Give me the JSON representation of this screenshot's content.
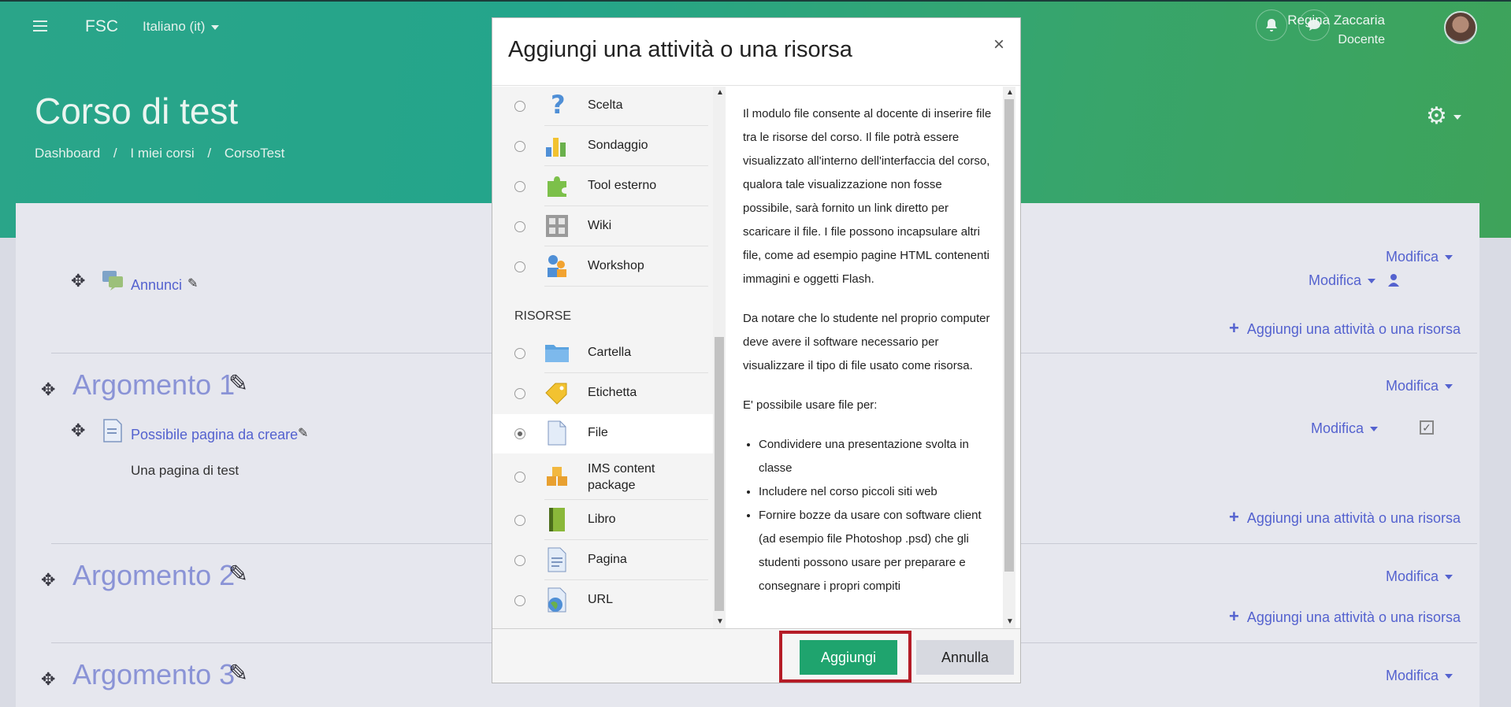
{
  "navbar": {
    "brand": "FSC",
    "language": "Italiano (it)",
    "user_name": "Regina Zaccaria",
    "user_role": "Docente"
  },
  "course": {
    "title": "Corso di test",
    "breadcrumb": [
      "Dashboard",
      "/",
      "I miei corsi",
      "/",
      "CorsoTest"
    ]
  },
  "main": {
    "edit_label": "Modifica",
    "add_activity_label": "Aggiungi una attività o una risorsa",
    "announcements": "Annunci",
    "sections": [
      {
        "title": "Argomento 1"
      },
      {
        "title": "Argomento 2"
      },
      {
        "title": "Argomento 3"
      }
    ],
    "page_item": "Possibile pagina da creare",
    "page_item_desc": "Una pagina di test"
  },
  "modal": {
    "title": "Aggiungi una attività o una risorsa",
    "close": "×",
    "resources_heading": "RISORSE",
    "options": [
      {
        "label": "Scelta",
        "icon": "question-icon",
        "selected": false
      },
      {
        "label": "Sondaggio",
        "icon": "bar-chart-icon",
        "selected": false
      },
      {
        "label": "Tool esterno",
        "icon": "puzzle-icon",
        "selected": false
      },
      {
        "label": "Wiki",
        "icon": "wiki-icon",
        "selected": false
      },
      {
        "label": "Workshop",
        "icon": "workshop-icon",
        "selected": false
      },
      {
        "label": "Cartella",
        "icon": "folder-icon",
        "selected": false
      },
      {
        "label": "Etichetta",
        "icon": "tag-icon",
        "selected": false
      },
      {
        "label": "File",
        "icon": "file-icon",
        "selected": true
      },
      {
        "label": "IMS content package",
        "icon": "package-icon",
        "selected": false
      },
      {
        "label": "Libro",
        "icon": "book-icon",
        "selected": false
      },
      {
        "label": "Pagina",
        "icon": "page-icon",
        "selected": false
      },
      {
        "label": "URL",
        "icon": "globe-icon",
        "selected": false
      }
    ],
    "description": {
      "p1": "Il modulo file consente al docente di inserire file tra le risorse del corso. Il file potrà essere visualizzato all'interno dell'interfaccia del corso, qualora tale visualizzazione non fosse possibile, sarà fornito un link diretto per scaricare il file. I file possono incapsulare altri file, come ad esempio pagine HTML contenenti immagini e oggetti Flash.",
      "p2": "Da notare che lo studente nel proprio computer deve avere il software necessario per visualizzare il tipo di file usato come risorsa.",
      "p3": "E' possibile usare file per:",
      "bullets": [
        "Condividere una presentazione svolta in classe",
        "Includere nel corso piccoli siti web",
        "Fornire bozze da usare con software client (ad esempio file Photoshop .psd) che gli studenti possono usare per preparare e consegnare i propri compiti"
      ]
    },
    "add_button": "Aggiungi",
    "cancel_button": "Annulla"
  },
  "colors": {
    "header_green": "#2aa589",
    "link_blue": "#5462cf",
    "add_button": "#1fa46e",
    "highlight_red": "#b51c27"
  }
}
